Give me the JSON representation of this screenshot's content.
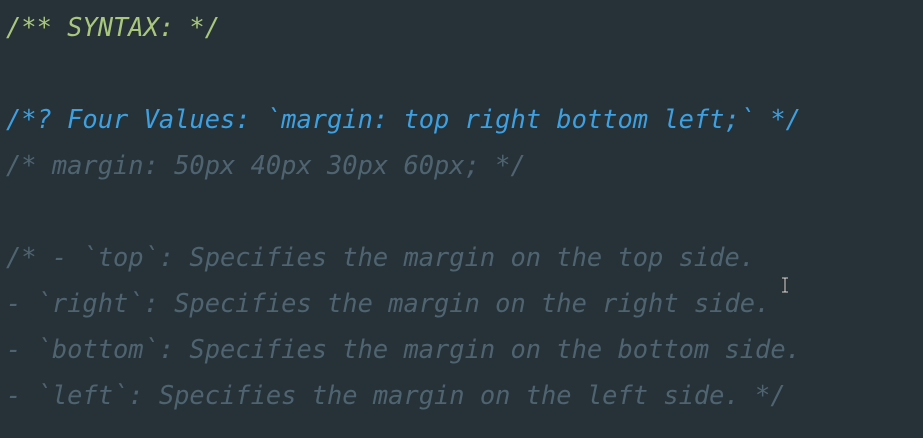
{
  "editor": {
    "theme_colors": {
      "background": "#263238",
      "doc_comment": "#a9c77d",
      "highlight_comment": "#3ea0e0",
      "comment": "#4f6470"
    },
    "lines": [
      "/** SYNTAX: */",
      "",
      "/*? Four Values: `margin: top right bottom left;` */",
      "/* margin: 50px 40px 30px 60px; */",
      "",
      "/* - `top`: Specifies the margin on the top side.",
      "- `right`: Specifies the margin on the right side.",
      "- `bottom`: Specifies the margin on the bottom side.",
      "- `left`: Specifies the margin on the left side. */"
    ],
    "mouse_cursor": "i-beam-cursor-icon"
  }
}
